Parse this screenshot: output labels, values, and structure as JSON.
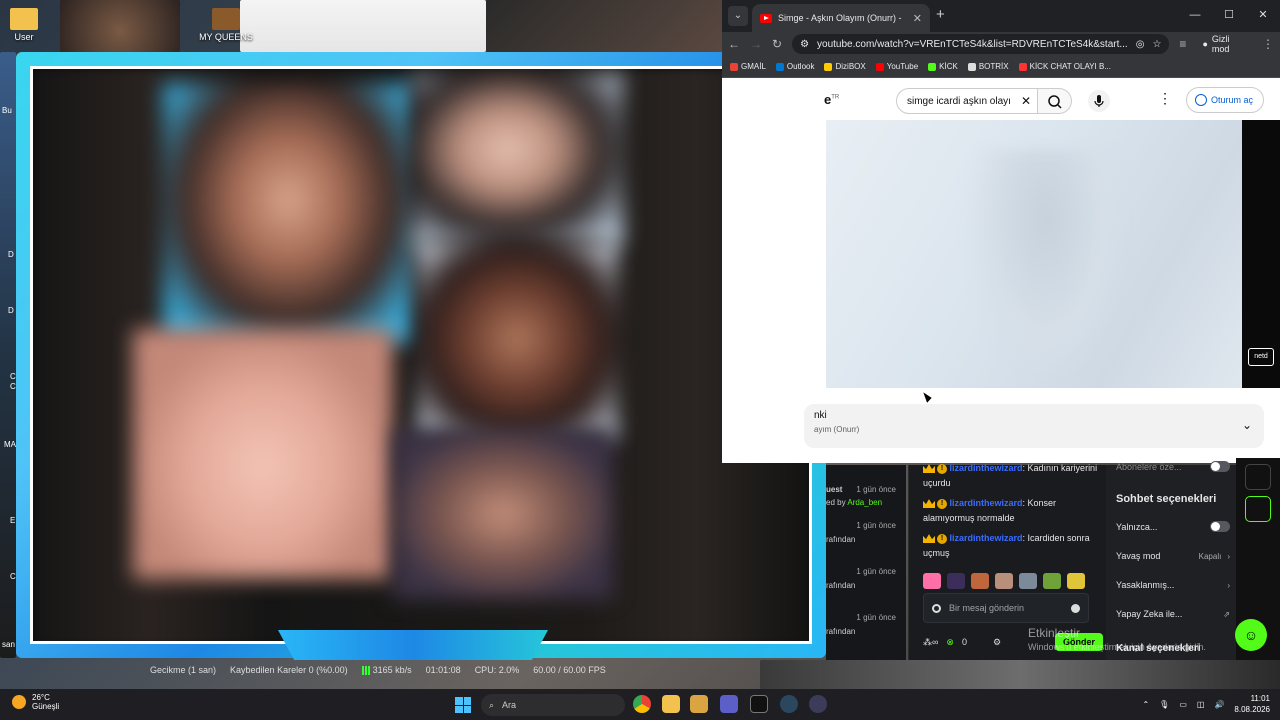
{
  "desktop": {
    "icons": [
      {
        "label": "User"
      },
      {
        "label": "MY QUEENS"
      }
    ],
    "side_fragments": [
      "Bu",
      "D",
      "D",
      "C",
      "C",
      "MA",
      "E",
      "C",
      "san"
    ]
  },
  "obs_status": {
    "delay": "Gecikme (1 san)",
    "dropped_frames": "Kaybedilen Kareler 0 (%0.00)",
    "bitrate": "3165 kb/s",
    "time": "01:01:08",
    "cpu": "CPU: 2.0%",
    "fps": "60.00 / 60.00 FPS"
  },
  "browser": {
    "tab_title": "Simge - Aşkın Olayım (Onurr) -",
    "url": "youtube.com/watch?v=VREnTCTeS4k&list=RDVREnTCTeS4k&start...",
    "incognito_label": "Gizli mod",
    "bookmarks": [
      {
        "label": "GMAİL",
        "color": "#ea4335"
      },
      {
        "label": "Outlook",
        "color": "#0078d4"
      },
      {
        "label": "DiziBOX",
        "color": "#ffcc00"
      },
      {
        "label": "YouTube",
        "color": "#ff0000"
      },
      {
        "label": "KİCK",
        "color": "#53fc18"
      },
      {
        "label": "BOTRİX",
        "color": "#dddddd"
      },
      {
        "label": "KİCK CHAT OLAYI B...",
        "color": "#ff3333"
      }
    ]
  },
  "youtube": {
    "logo_fragment": "e",
    "region": "TR",
    "search_query": "simge icardi aşkın olayı",
    "signin_label": "Oturum aç",
    "channel_badge": "netd",
    "playlist_title": "nki",
    "playlist_subtitle": "ayım (Onurr)"
  },
  "chat_left": {
    "rows": [
      {
        "name": "uest",
        "time": "1 gün önce",
        "by": "ed by",
        "user": "Arda_ben"
      },
      {
        "name": "rafından",
        "time": "1 gün önce"
      },
      {
        "name": "rafından",
        "time": "1 gün önce"
      },
      {
        "name": "rafından",
        "time": "1 gün önce"
      }
    ]
  },
  "chat": {
    "messages": [
      {
        "user": "lizardinthewizard",
        "text": ": Kadının kariyerini uçurdu"
      },
      {
        "user": "lizardinthewizard",
        "text": ": Konser alamıyormuş normalde"
      },
      {
        "user": "lizardinthewizard",
        "text": ": Icardiden sonra uçmuş"
      }
    ],
    "input_placeholder": "Bir mesaj gönderin",
    "points": "0",
    "send_label": "Gönder"
  },
  "chat_settings": {
    "top_fragment": "Abonelere öze...",
    "header": "Sohbet seçenekleri",
    "items": [
      {
        "label": "Yalnızca...",
        "value": ""
      },
      {
        "label": "Yavaş mod",
        "value": "Kapalı"
      },
      {
        "label": "Yasaklanmış...",
        "value": ""
      },
      {
        "label": "Yapay Zeka ile...",
        "value": ""
      }
    ],
    "channel_options": "Kanal seçenekleri",
    "settings_fragment": "din."
  },
  "watermark": {
    "title": "Etkinleştir",
    "subtitle": "Windows'u etkinleştirmek için Ayarlar'a gidin."
  },
  "taskbar": {
    "temperature": "26°C",
    "weather_label": "Güneşli",
    "search_placeholder": "Ara",
    "time": "11:01",
    "date": "8.08.2026"
  }
}
